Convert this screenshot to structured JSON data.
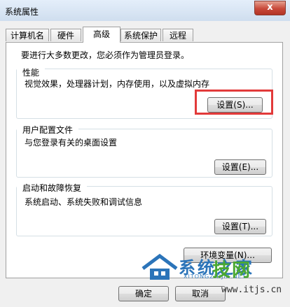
{
  "window": {
    "title": "系统属性",
    "close_label": "x"
  },
  "tabs": [
    {
      "label": "计算机名"
    },
    {
      "label": "硬件"
    },
    {
      "label": "高级"
    },
    {
      "label": "系统保护"
    },
    {
      "label": "远程"
    }
  ],
  "active_tab": "高级",
  "admin_note": "要进行大多数更改，您必须作为管理员登录。",
  "groups": {
    "performance": {
      "title": "性能",
      "desc": "视觉效果，处理器计划，内存使用，以及虚拟内存",
      "button": "设置(S)..."
    },
    "user_profiles": {
      "title": "用户配置文件",
      "desc": "与您登录有关的桌面设置",
      "button": "设置(E)..."
    },
    "startup": {
      "title": "启动和故障恢复",
      "desc": "系统启动、系统失败和调试信息",
      "button": "设置(T)..."
    }
  },
  "env_button": "环境变量(N)...",
  "ok_button": "确定",
  "cancel_button": "取消",
  "watermark": {
    "text1": "系统之家",
    "text1_small": "XITONGZHIJIA.NET",
    "text2": "技网",
    "text3": "www.itjs.cn"
  },
  "colors": {
    "highlight": "#e23a3a",
    "close": "#c8493a"
  }
}
